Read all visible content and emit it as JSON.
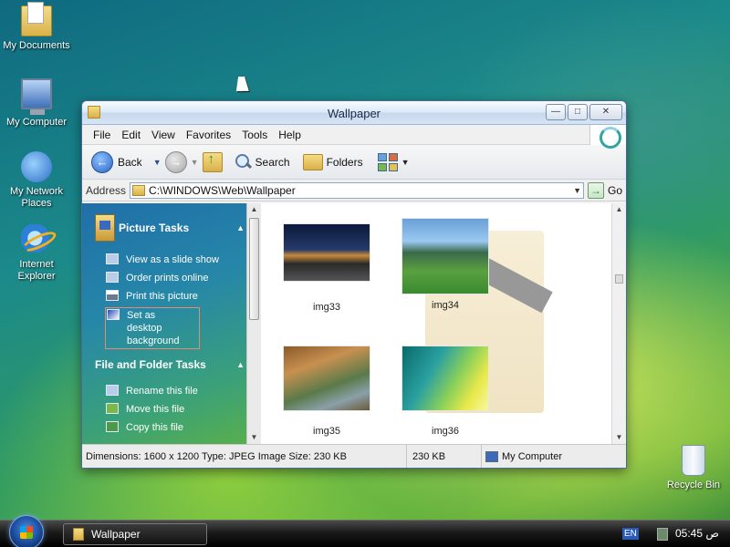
{
  "desktop": {
    "icons": [
      {
        "label": "My Documents"
      },
      {
        "label": "My Computer"
      },
      {
        "label": "My Network Places"
      },
      {
        "label": "Internet Explorer"
      },
      {
        "label": "Recycle Bin"
      }
    ]
  },
  "window": {
    "title": "Wallpaper",
    "menu": [
      "File",
      "Edit",
      "View",
      "Favorites",
      "Tools",
      "Help"
    ],
    "toolbar": {
      "back_label": "Back",
      "search_label": "Search",
      "folders_label": "Folders"
    },
    "address": {
      "label": "Address",
      "value": "C:\\WINDOWS\\Web\\Wallpaper",
      "go_label": "Go"
    },
    "tasks": {
      "picture_tasks": {
        "heading": "Picture Tasks",
        "items": [
          "View as a slide show",
          "Order prints online",
          "Print this picture",
          "Set as desktop background"
        ]
      },
      "file_folder_tasks": {
        "heading": "File and Folder Tasks",
        "items": [
          "Rename this file",
          "Move this file",
          "Copy this file"
        ]
      }
    },
    "files": [
      {
        "name": "img33"
      },
      {
        "name": "img34"
      },
      {
        "name": "img35"
      },
      {
        "name": "img36"
      }
    ],
    "status": {
      "info": "Dimensions: 1600 x 1200 Type: JPEG Image Size: 230 KB",
      "size": "230 KB",
      "zone": "My Computer"
    }
  },
  "taskbar": {
    "window_button": "Wallpaper",
    "language": "EN",
    "clock": "05:45 ص"
  }
}
